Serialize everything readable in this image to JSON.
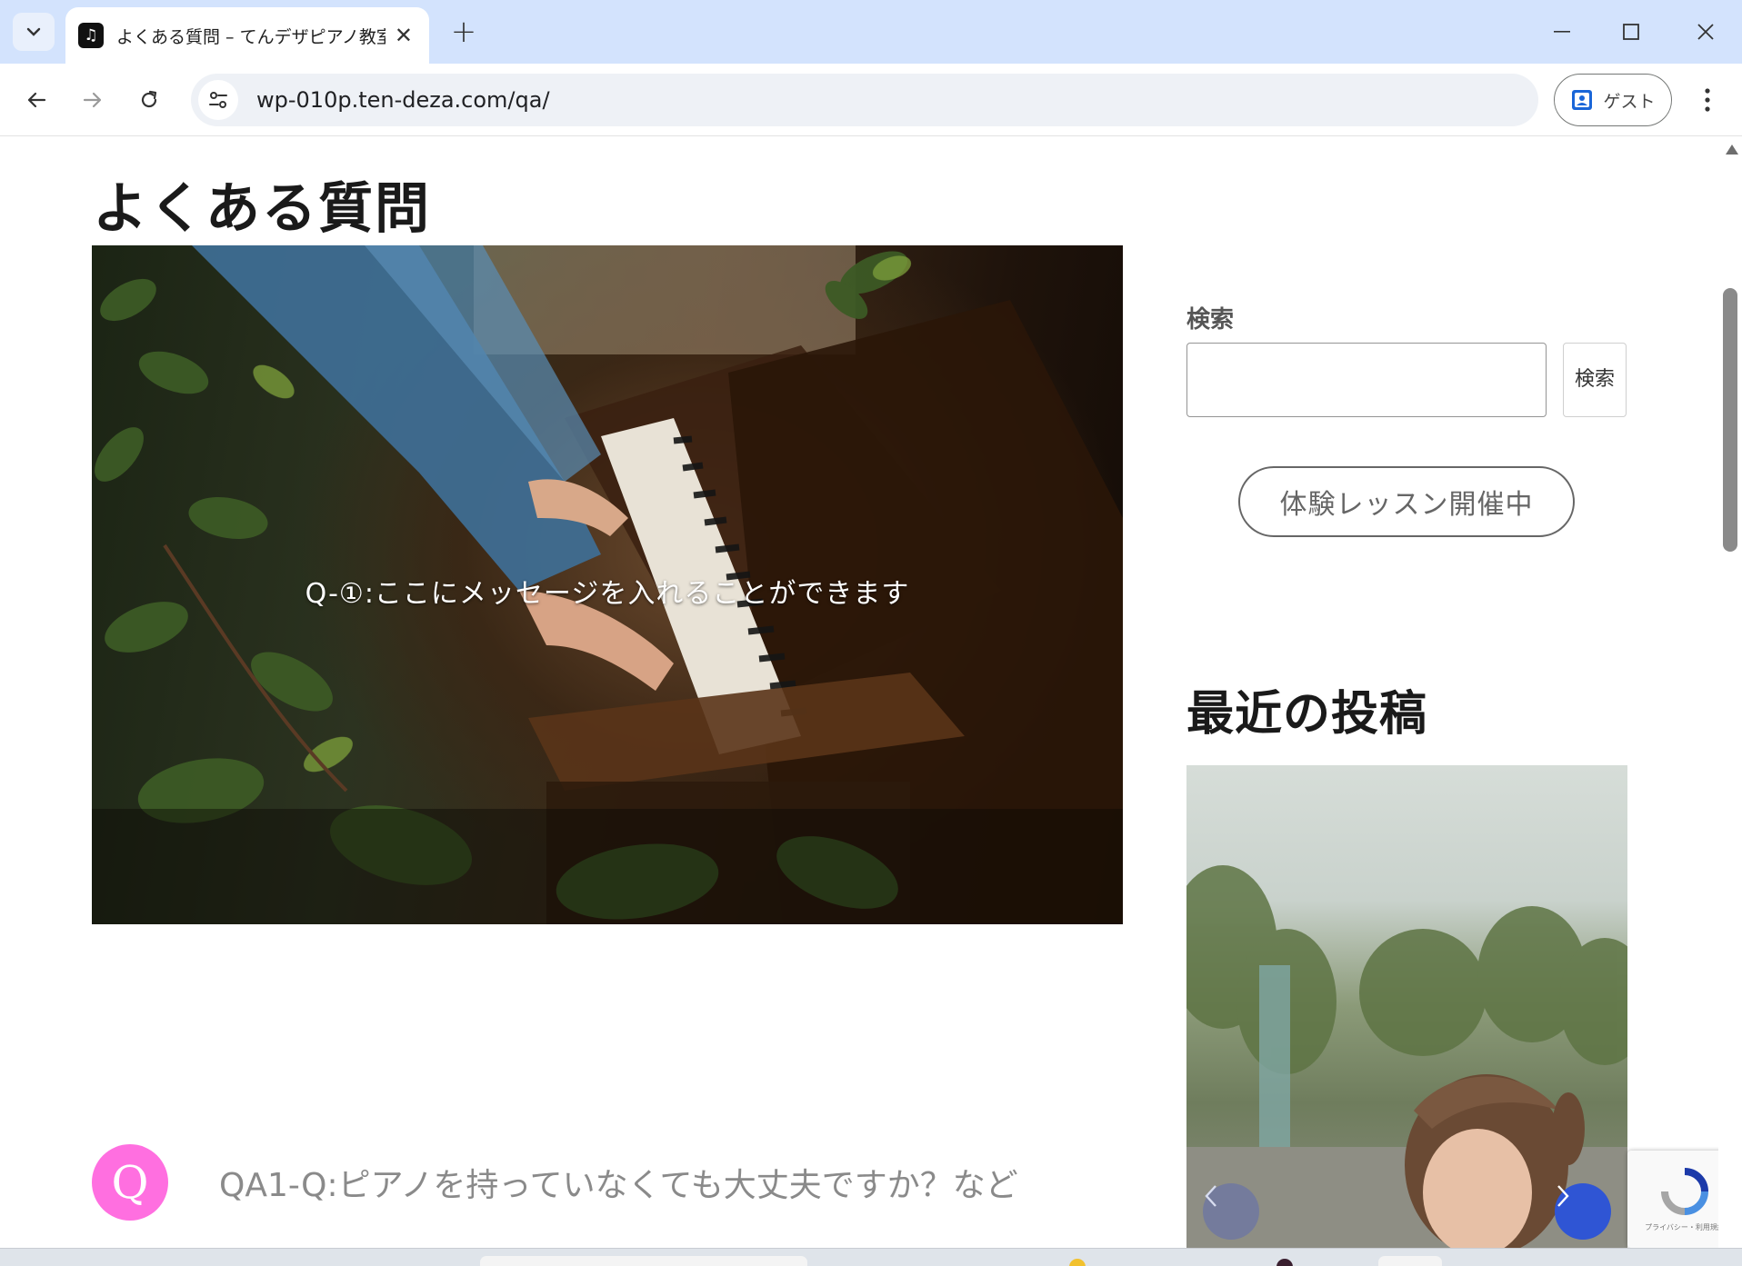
{
  "browser": {
    "tab_title": "よくある質問 – てんデザピアノ教室♪",
    "tab_favicon": "music-note-icon",
    "url": "wp-010p.ten-deza.com/qa/",
    "profile_label": "ゲスト"
  },
  "page": {
    "title": "よくある質問",
    "hero_caption": "Q-①:ここにメッセージを入れることができます",
    "qa": {
      "badge": "Q",
      "question": "QA1-Q:ピアノを持っていなくても大丈夫ですか？など"
    }
  },
  "sidebar": {
    "search_label": "検索",
    "search_value": "",
    "search_button": "検索",
    "trial_button": "体験レッスン開催中",
    "recent_title": "最近の投稿"
  },
  "recaptcha_text": "プライバシー・利用規約",
  "colors": {
    "tab_strip": "#d3e3fd",
    "qa_badge": "#ff6fe0",
    "slider_next": "#2f55d4"
  }
}
